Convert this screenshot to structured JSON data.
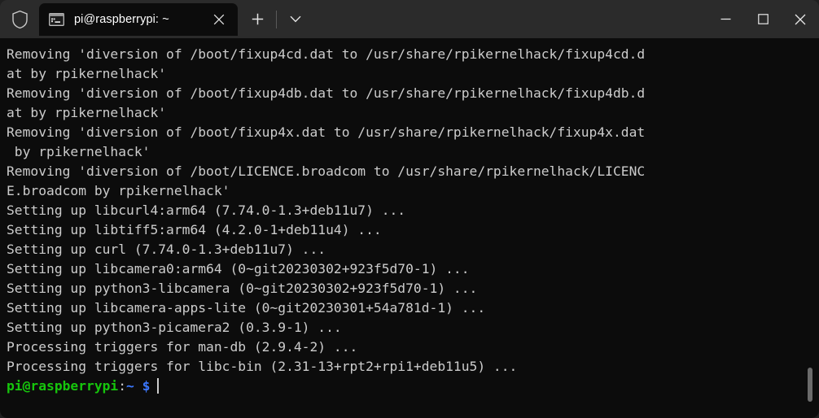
{
  "window": {
    "titlebar": {
      "shield_icon": "shield-icon",
      "tabs": [
        {
          "icon": "console-icon",
          "title": "pi@raspberrypi: ~",
          "close_label": "✕",
          "active": true
        }
      ],
      "new_tab_label": "+",
      "dropdown_label": "⌄",
      "controls": {
        "minimize": "—",
        "maximize": "□",
        "close": "✕"
      }
    },
    "colors": {
      "titlebar_bg": "#2b2b2b",
      "terminal_bg": "#0c0c0c",
      "text": "#cccccc",
      "prompt_user": "#16c60c",
      "prompt_path": "#3b78ff",
      "scrollbar": "#6b6b6b"
    }
  },
  "terminal": {
    "lines": [
      "Removing 'diversion of /boot/fixup4cd.dat to /usr/share/rpikernelhack/fixup4cd.d",
      "at by rpikernelhack'",
      "Removing 'diversion of /boot/fixup4db.dat to /usr/share/rpikernelhack/fixup4db.d",
      "at by rpikernelhack'",
      "Removing 'diversion of /boot/fixup4x.dat to /usr/share/rpikernelhack/fixup4x.dat",
      " by rpikernelhack'",
      "Removing 'diversion of /boot/LICENCE.broadcom to /usr/share/rpikernelhack/LICENC",
      "E.broadcom by rpikernelhack'",
      "Setting up libcurl4:arm64 (7.74.0-1.3+deb11u7) ...",
      "Setting up libtiff5:arm64 (4.2.0-1+deb11u4) ...",
      "Setting up curl (7.74.0-1.3+deb11u7) ...",
      "Setting up libcamera0:arm64 (0~git20230302+923f5d70-1) ...",
      "Setting up python3-libcamera (0~git20230302+923f5d70-1) ...",
      "Setting up libcamera-apps-lite (0~git20230301+54a781d-1) ...",
      "Setting up python3-picamera2 (0.3.9-1) ...",
      "Processing triggers for man-db (2.9.4-2) ...",
      "Processing triggers for libc-bin (2.31-13+rpt2+rpi1+deb11u5) ..."
    ],
    "prompt": {
      "user_host": "pi@raspberrypi",
      "colon": ":",
      "path": "~",
      "symbol": "$",
      "input": ""
    }
  }
}
